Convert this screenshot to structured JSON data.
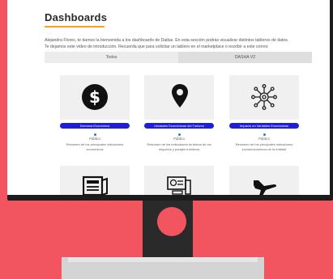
{
  "page": {
    "title": "Dashboards",
    "intro_line1": "Alejandra Flores, te damos la bienvenida a los dashboards de Datlas. En esta sección podrás visualizar distintos tableros de datos.",
    "intro_line2": "Te dejamos este video de introducción. Recuerda que para solicitar un tablero en el marketplace o escribir a este correo"
  },
  "tabs": [
    {
      "label": "Todos"
    },
    {
      "label": "DASHA V2"
    }
  ],
  "cards": [
    {
      "button": "Derrama Económica",
      "status": "Público",
      "desc": "Resumen de los principales indicadores económicos",
      "icon": "dollar-icon"
    },
    {
      "button": "Unidades Económicas del Turismo",
      "status": "Público",
      "desc": "Resumen de los indicadores turísticos de los negocios y parajes turísticos",
      "icon": "map-pin-icon"
    },
    {
      "button": "Impacto en Variables Económicas",
      "status": "Público",
      "desc": "Resumen de los principales indicadores socioeconómicos de la entidad",
      "icon": "network-icon"
    }
  ],
  "bottom_cards": [
    {
      "icon": "newspaper-icon"
    },
    {
      "icon": "analytics-computer-icon"
    },
    {
      "icon": "airplane-icon"
    }
  ]
}
